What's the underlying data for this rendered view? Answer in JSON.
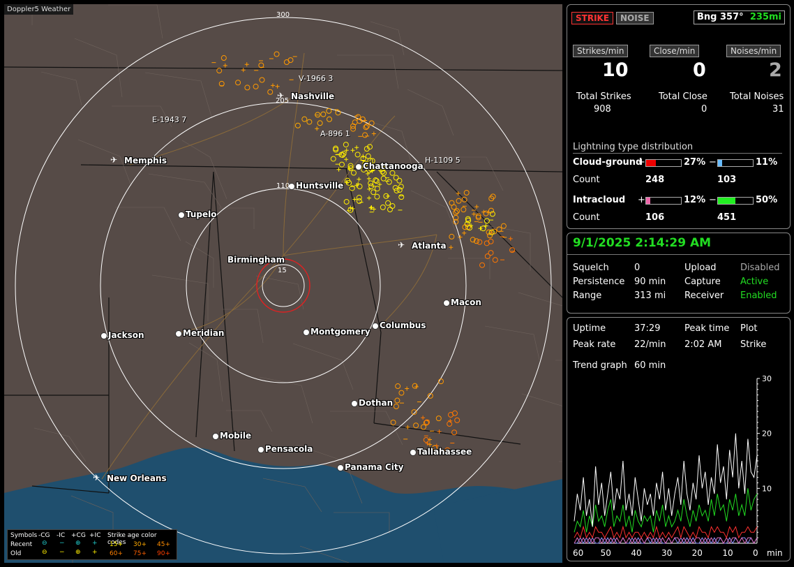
{
  "app_title": "Doppler5 Weather",
  "map": {
    "ring_labels": [
      "300",
      "205",
      "110",
      "15"
    ],
    "cities": [
      {
        "name": "Nashville",
        "airport": true
      },
      {
        "name": "Memphis",
        "airport": true
      },
      {
        "name": "Chattanooga",
        "airport": false
      },
      {
        "name": "Huntsville",
        "airport": false
      },
      {
        "name": "Tupelo",
        "airport": false
      },
      {
        "name": "Birmingham",
        "airport": false
      },
      {
        "name": "Atlanta",
        "airport": true
      },
      {
        "name": "Macon",
        "airport": false
      },
      {
        "name": "Jackson",
        "airport": false
      },
      {
        "name": "Meridian",
        "airport": false
      },
      {
        "name": "Montgomery",
        "airport": false
      },
      {
        "name": "Columbus",
        "airport": false
      },
      {
        "name": "Dothan",
        "airport": false
      },
      {
        "name": "Mobile",
        "airport": false
      },
      {
        "name": "Pensacola",
        "airport": false
      },
      {
        "name": "Panama City",
        "airport": false
      },
      {
        "name": "Tallahassee",
        "airport": false
      },
      {
        "name": "New Orleans",
        "airport": true
      }
    ],
    "storm_labels": [
      "V-1966 3",
      "E-1943 7",
      "A-896 1",
      "H-1109 5"
    ]
  },
  "legend": {
    "symbols_label": "Symbols",
    "neg_cg": "-CG",
    "neg_ic": "-IC",
    "pos_cg": "+CG",
    "pos_ic": "+IC",
    "age_label": "Strike age color codes",
    "recent": "Recent",
    "old": "Old",
    "recent_ages": [
      "15+",
      "30+",
      "45+"
    ],
    "old_ages": [
      "60+",
      "75+",
      "90+"
    ]
  },
  "top_panel": {
    "strike_btn": "STRIKE",
    "noise_btn": "NOISE",
    "bearing": "Bng 357°",
    "distance": "235mi",
    "strikes_min_btn": "Strikes/min",
    "close_min_btn": "Close/min",
    "noises_min_btn": "Noises/min",
    "strikes_min": "10",
    "close_min": "0",
    "noises_min": "2",
    "total_strikes_label": "Total Strikes",
    "total_close_label": "Total Close",
    "total_noises_label": "Total Noises",
    "total_strikes": "908",
    "total_close": "0",
    "total_noises": "31",
    "dist_title": "Lightning type distribution",
    "cg_label": "Cloud-ground",
    "ic_label": "Intracloud",
    "count_label": "Count",
    "cg_pos_pct": "27%",
    "cg_neg_pct": "11%",
    "cg_pos_count": "248",
    "cg_neg_count": "103",
    "ic_pos_pct": "12%",
    "ic_neg_pct": "50%",
    "ic_pos_count": "106",
    "ic_neg_count": "451",
    "cg_pos_frac": 0.27,
    "cg_neg_frac": 0.11,
    "ic_pos_frac": 0.12,
    "ic_neg_frac": 0.5,
    "plus": "+",
    "minus": "−"
  },
  "status_panel": {
    "datetime": "9/1/2025 2:14:29 AM",
    "squelch_label": "Squelch",
    "squelch": "0",
    "upload_label": "Upload",
    "upload": "Disabled",
    "persistence_label": "Persistence",
    "persistence": "90 min",
    "capture_label": "Capture",
    "capture": "Active",
    "range_label": "Range",
    "range": "313 mi",
    "receiver_label": "Receiver",
    "receiver": "Enabled"
  },
  "trend_panel": {
    "uptime_label": "Uptime",
    "uptime": "37:29",
    "peak_time_label": "Peak time",
    "plot_label": "Plot",
    "peak_rate_label": "Peak rate",
    "peak_rate": "22/min",
    "peak_time": "2:02 AM",
    "plot": "Strike",
    "trend_label": "Trend graph",
    "trend": "60 min"
  },
  "chart_data": {
    "type": "line",
    "x_ticks": [
      "60",
      "50",
      "40",
      "30",
      "20",
      "10",
      "0"
    ],
    "x_unit": "min",
    "y_ticks": [
      "30",
      "20",
      "10"
    ],
    "ylim": [
      0,
      30
    ],
    "series": [
      {
        "color": "#ffffff",
        "values": [
          4,
          9,
          6,
          12,
          5,
          8,
          3,
          14,
          7,
          11,
          5,
          9,
          13,
          6,
          10,
          8,
          15,
          6,
          9,
          5,
          12,
          8,
          4,
          10,
          7,
          9,
          5,
          11,
          8,
          13,
          6,
          10,
          5,
          9,
          12,
          7,
          15,
          9,
          6,
          11,
          8,
          16,
          10,
          13,
          7,
          12,
          9,
          18,
          11,
          14,
          8,
          17,
          12,
          20,
          10,
          15,
          9,
          19,
          13,
          12,
          16
        ]
      },
      {
        "color": "#22dd22",
        "values": [
          2,
          4,
          3,
          6,
          2,
          5,
          3,
          7,
          4,
          5,
          3,
          6,
          8,
          3,
          5,
          4,
          7,
          3,
          5,
          2,
          6,
          4,
          3,
          5,
          4,
          5,
          2,
          6,
          4,
          7,
          3,
          5,
          3,
          4,
          6,
          4,
          8,
          5,
          3,
          6,
          4,
          7,
          5,
          6,
          4,
          8,
          5,
          9,
          6,
          7,
          4,
          8,
          6,
          9,
          5,
          7,
          5,
          10,
          6,
          8,
          9
        ]
      },
      {
        "color": "#ff3030",
        "values": [
          1,
          2,
          1,
          3,
          1,
          2,
          1,
          3,
          2,
          2,
          1,
          2,
          3,
          1,
          2,
          1,
          3,
          1,
          2,
          1,
          2,
          2,
          1,
          2,
          1,
          2,
          1,
          3,
          1,
          2,
          1,
          2,
          1,
          2,
          3,
          1,
          3,
          2,
          1,
          2,
          1,
          3,
          2,
          2,
          1,
          3,
          2,
          3,
          2,
          2,
          1,
          3,
          2,
          3,
          1,
          2,
          2,
          3,
          2,
          2,
          3
        ]
      },
      {
        "color": "#e070c0",
        "values": [
          0,
          1,
          0,
          1,
          0,
          1,
          0,
          1,
          1,
          0,
          1,
          0,
          1,
          0,
          1,
          0,
          1,
          0,
          1,
          0,
          1,
          0,
          1,
          0,
          1,
          1,
          0,
          1,
          0,
          1,
          0,
          1,
          0,
          1,
          1,
          0,
          1,
          0,
          1,
          0,
          1,
          1,
          0,
          1,
          0,
          1,
          0,
          1,
          1,
          0,
          1,
          0,
          1,
          1,
          0,
          1,
          0,
          1,
          1,
          0,
          1
        ]
      },
      {
        "color": "#9090ff",
        "values": [
          0,
          0,
          1,
          0,
          1,
          0,
          1,
          0,
          0,
          1,
          0,
          1,
          0,
          1,
          0,
          0,
          1,
          0,
          0,
          1,
          0,
          1,
          0,
          0,
          1,
          0,
          1,
          0,
          1,
          0,
          0,
          1,
          0,
          1,
          0,
          1,
          0,
          1,
          0,
          1,
          0,
          0,
          1,
          0,
          1,
          0,
          1,
          0,
          1,
          0,
          0,
          1,
          0,
          1,
          0,
          1,
          1,
          0,
          1,
          0,
          1
        ]
      }
    ]
  }
}
